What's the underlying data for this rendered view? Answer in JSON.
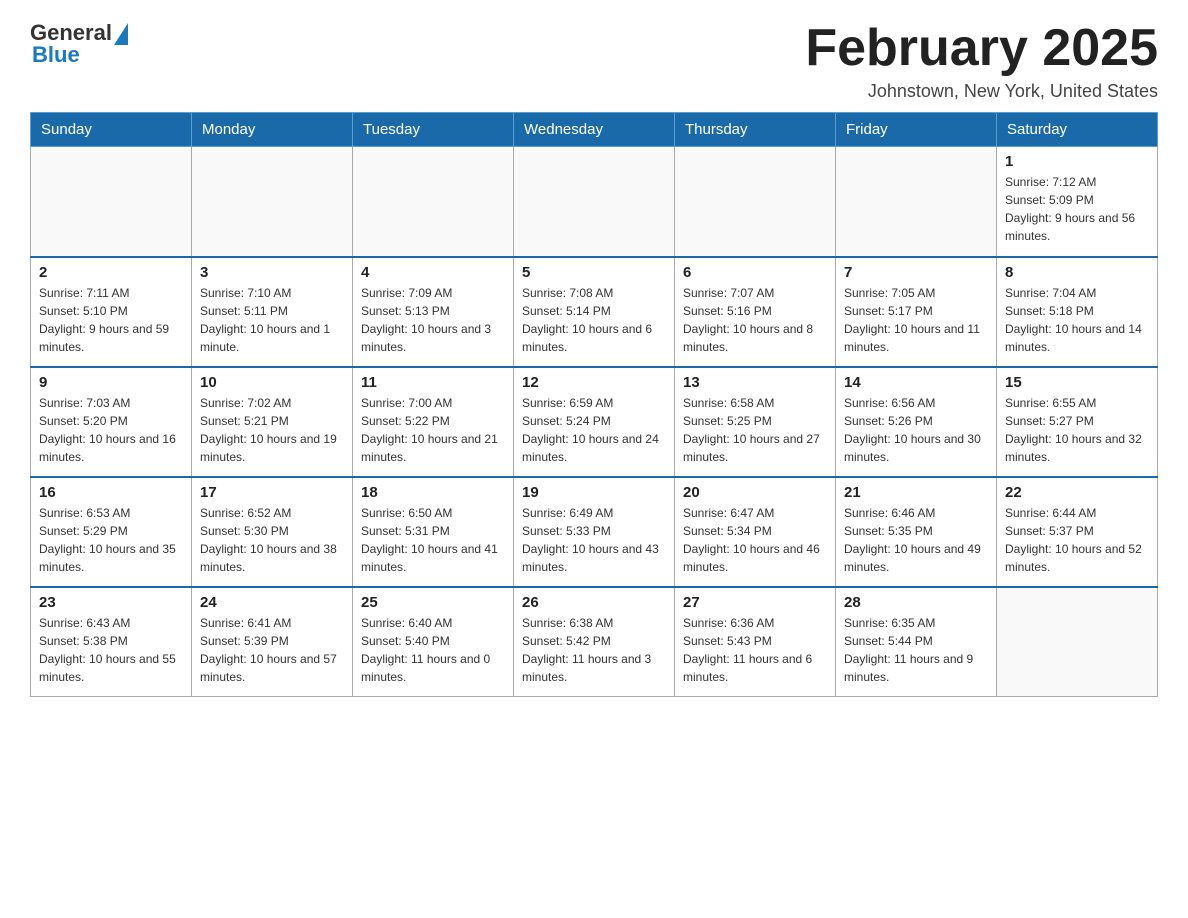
{
  "header": {
    "logo_general": "General",
    "logo_blue": "Blue",
    "month_title": "February 2025",
    "location": "Johnstown, New York, United States"
  },
  "weekdays": [
    "Sunday",
    "Monday",
    "Tuesday",
    "Wednesday",
    "Thursday",
    "Friday",
    "Saturday"
  ],
  "weeks": [
    [
      {
        "day": "",
        "sunrise": "",
        "sunset": "",
        "daylight": ""
      },
      {
        "day": "",
        "sunrise": "",
        "sunset": "",
        "daylight": ""
      },
      {
        "day": "",
        "sunrise": "",
        "sunset": "",
        "daylight": ""
      },
      {
        "day": "",
        "sunrise": "",
        "sunset": "",
        "daylight": ""
      },
      {
        "day": "",
        "sunrise": "",
        "sunset": "",
        "daylight": ""
      },
      {
        "day": "",
        "sunrise": "",
        "sunset": "",
        "daylight": ""
      },
      {
        "day": "1",
        "sunrise": "Sunrise: 7:12 AM",
        "sunset": "Sunset: 5:09 PM",
        "daylight": "Daylight: 9 hours and 56 minutes."
      }
    ],
    [
      {
        "day": "2",
        "sunrise": "Sunrise: 7:11 AM",
        "sunset": "Sunset: 5:10 PM",
        "daylight": "Daylight: 9 hours and 59 minutes."
      },
      {
        "day": "3",
        "sunrise": "Sunrise: 7:10 AM",
        "sunset": "Sunset: 5:11 PM",
        "daylight": "Daylight: 10 hours and 1 minute."
      },
      {
        "day": "4",
        "sunrise": "Sunrise: 7:09 AM",
        "sunset": "Sunset: 5:13 PM",
        "daylight": "Daylight: 10 hours and 3 minutes."
      },
      {
        "day": "5",
        "sunrise": "Sunrise: 7:08 AM",
        "sunset": "Sunset: 5:14 PM",
        "daylight": "Daylight: 10 hours and 6 minutes."
      },
      {
        "day": "6",
        "sunrise": "Sunrise: 7:07 AM",
        "sunset": "Sunset: 5:16 PM",
        "daylight": "Daylight: 10 hours and 8 minutes."
      },
      {
        "day": "7",
        "sunrise": "Sunrise: 7:05 AM",
        "sunset": "Sunset: 5:17 PM",
        "daylight": "Daylight: 10 hours and 11 minutes."
      },
      {
        "day": "8",
        "sunrise": "Sunrise: 7:04 AM",
        "sunset": "Sunset: 5:18 PM",
        "daylight": "Daylight: 10 hours and 14 minutes."
      }
    ],
    [
      {
        "day": "9",
        "sunrise": "Sunrise: 7:03 AM",
        "sunset": "Sunset: 5:20 PM",
        "daylight": "Daylight: 10 hours and 16 minutes."
      },
      {
        "day": "10",
        "sunrise": "Sunrise: 7:02 AM",
        "sunset": "Sunset: 5:21 PM",
        "daylight": "Daylight: 10 hours and 19 minutes."
      },
      {
        "day": "11",
        "sunrise": "Sunrise: 7:00 AM",
        "sunset": "Sunset: 5:22 PM",
        "daylight": "Daylight: 10 hours and 21 minutes."
      },
      {
        "day": "12",
        "sunrise": "Sunrise: 6:59 AM",
        "sunset": "Sunset: 5:24 PM",
        "daylight": "Daylight: 10 hours and 24 minutes."
      },
      {
        "day": "13",
        "sunrise": "Sunrise: 6:58 AM",
        "sunset": "Sunset: 5:25 PM",
        "daylight": "Daylight: 10 hours and 27 minutes."
      },
      {
        "day": "14",
        "sunrise": "Sunrise: 6:56 AM",
        "sunset": "Sunset: 5:26 PM",
        "daylight": "Daylight: 10 hours and 30 minutes."
      },
      {
        "day": "15",
        "sunrise": "Sunrise: 6:55 AM",
        "sunset": "Sunset: 5:27 PM",
        "daylight": "Daylight: 10 hours and 32 minutes."
      }
    ],
    [
      {
        "day": "16",
        "sunrise": "Sunrise: 6:53 AM",
        "sunset": "Sunset: 5:29 PM",
        "daylight": "Daylight: 10 hours and 35 minutes."
      },
      {
        "day": "17",
        "sunrise": "Sunrise: 6:52 AM",
        "sunset": "Sunset: 5:30 PM",
        "daylight": "Daylight: 10 hours and 38 minutes."
      },
      {
        "day": "18",
        "sunrise": "Sunrise: 6:50 AM",
        "sunset": "Sunset: 5:31 PM",
        "daylight": "Daylight: 10 hours and 41 minutes."
      },
      {
        "day": "19",
        "sunrise": "Sunrise: 6:49 AM",
        "sunset": "Sunset: 5:33 PM",
        "daylight": "Daylight: 10 hours and 43 minutes."
      },
      {
        "day": "20",
        "sunrise": "Sunrise: 6:47 AM",
        "sunset": "Sunset: 5:34 PM",
        "daylight": "Daylight: 10 hours and 46 minutes."
      },
      {
        "day": "21",
        "sunrise": "Sunrise: 6:46 AM",
        "sunset": "Sunset: 5:35 PM",
        "daylight": "Daylight: 10 hours and 49 minutes."
      },
      {
        "day": "22",
        "sunrise": "Sunrise: 6:44 AM",
        "sunset": "Sunset: 5:37 PM",
        "daylight": "Daylight: 10 hours and 52 minutes."
      }
    ],
    [
      {
        "day": "23",
        "sunrise": "Sunrise: 6:43 AM",
        "sunset": "Sunset: 5:38 PM",
        "daylight": "Daylight: 10 hours and 55 minutes."
      },
      {
        "day": "24",
        "sunrise": "Sunrise: 6:41 AM",
        "sunset": "Sunset: 5:39 PM",
        "daylight": "Daylight: 10 hours and 57 minutes."
      },
      {
        "day": "25",
        "sunrise": "Sunrise: 6:40 AM",
        "sunset": "Sunset: 5:40 PM",
        "daylight": "Daylight: 11 hours and 0 minutes."
      },
      {
        "day": "26",
        "sunrise": "Sunrise: 6:38 AM",
        "sunset": "Sunset: 5:42 PM",
        "daylight": "Daylight: 11 hours and 3 minutes."
      },
      {
        "day": "27",
        "sunrise": "Sunrise: 6:36 AM",
        "sunset": "Sunset: 5:43 PM",
        "daylight": "Daylight: 11 hours and 6 minutes."
      },
      {
        "day": "28",
        "sunrise": "Sunrise: 6:35 AM",
        "sunset": "Sunset: 5:44 PM",
        "daylight": "Daylight: 11 hours and 9 minutes."
      },
      {
        "day": "",
        "sunrise": "",
        "sunset": "",
        "daylight": ""
      }
    ]
  ]
}
